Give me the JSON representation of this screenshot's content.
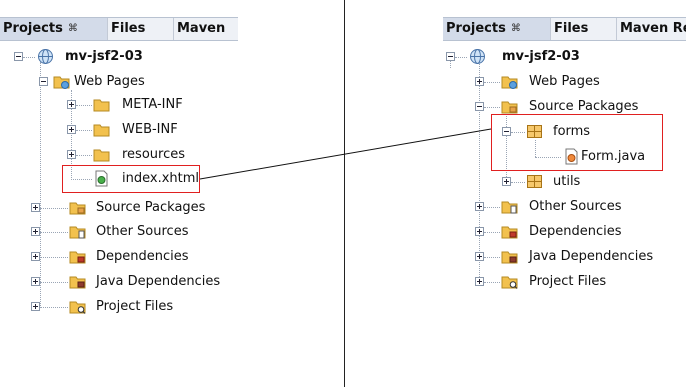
{
  "left_panel": {
    "tabs": [
      {
        "label": "Projects",
        "close_glyph": "⌘",
        "active": true
      },
      {
        "label": "Files",
        "active": false
      },
      {
        "label": "Maven",
        "active": false
      }
    ],
    "tree": [
      {
        "label": "mv-jsf2-03",
        "bold": true,
        "icon": "project-globe-icon",
        "expanded": true
      },
      {
        "label": "Web Pages",
        "icon": "web-pages-folder-icon",
        "expanded": true
      },
      {
        "label": "META-INF",
        "icon": "folder-icon",
        "expanded": false
      },
      {
        "label": "WEB-INF",
        "icon": "folder-icon",
        "expanded": false
      },
      {
        "label": "resources",
        "icon": "folder-icon",
        "expanded": false
      },
      {
        "label": "index.xhtml",
        "icon": "xhtml-file-icon",
        "highlighted": true
      },
      {
        "label": "Source Packages",
        "icon": "source-packages-icon",
        "expanded": false
      },
      {
        "label": "Other Sources",
        "icon": "other-sources-icon",
        "expanded": false
      },
      {
        "label": "Dependencies",
        "icon": "dependencies-icon",
        "expanded": false
      },
      {
        "label": "Java Dependencies",
        "icon": "java-dependencies-icon",
        "expanded": false
      },
      {
        "label": "Project Files",
        "icon": "project-files-icon",
        "expanded": false
      }
    ]
  },
  "right_panel": {
    "tabs": [
      {
        "label": "Projects",
        "close_glyph": "⌘",
        "active": true
      },
      {
        "label": "Files",
        "active": false
      },
      {
        "label": "Maven Re",
        "active": false
      }
    ],
    "tree": [
      {
        "label": "mv-jsf2-03",
        "bold": true,
        "icon": "project-globe-icon",
        "expanded": true
      },
      {
        "label": "Web Pages",
        "icon": "web-pages-folder-icon",
        "expanded": false
      },
      {
        "label": "Source Packages",
        "icon": "source-packages-icon",
        "expanded": true
      },
      {
        "label": "forms",
        "icon": "package-icon",
        "expanded": true,
        "highlighted": true
      },
      {
        "label": "Form.java",
        "icon": "java-file-icon",
        "highlighted": true
      },
      {
        "label": "utils",
        "icon": "package-icon",
        "expanded": false
      },
      {
        "label": "Other Sources",
        "icon": "other-sources-icon",
        "expanded": false
      },
      {
        "label": "Dependencies",
        "icon": "dependencies-icon",
        "expanded": false
      },
      {
        "label": "Java Dependencies",
        "icon": "java-dependencies-icon",
        "expanded": false
      },
      {
        "label": "Project Files",
        "icon": "project-files-icon",
        "expanded": false
      }
    ]
  },
  "colors": {
    "highlight": "#e02020",
    "divider": "#222222",
    "tabbar": "#eef1f6",
    "tree_lines": "#9aa5b5"
  }
}
